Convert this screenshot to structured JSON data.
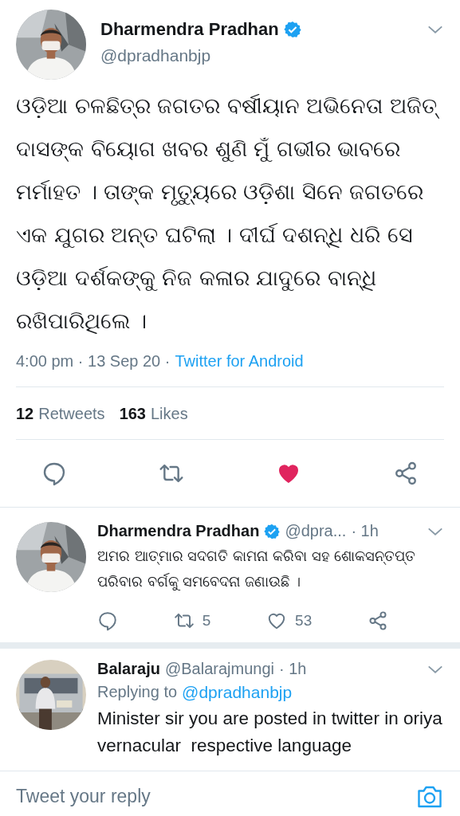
{
  "tweet": {
    "author": {
      "name": "Dharmendra Pradhan",
      "verified": true,
      "handle": "@dpradhanbjp"
    },
    "text": "ଓଡ଼ିଆ ଚଳଛିତ୍ର ଜଗତର ବର୍ଷୀୟାନ ଅଭିନେତା ଅଜିତ୍ ଦାସଙ୍କ ବିୟୋଗ ଖବର ଶୁଣି ମୁଁ ଗଭୀର ଭାବରେ ମର୍ମାହତ । ତାଙ୍କ ମୃତ୍ୟୁରେ ଓଡ଼ିଶା ସିନେ ଜଗତରେ ଏକ ଯୁଗର ଅନ୍ତ ଘଟିଲା । ଦୀର୍ଘ ଦଶନ୍ଧି ଧରି ସେ ଓଡ଼ିଆ ଦର୍ଶକଙ୍କୁ ନିଜ କଳାର ଯାଦୁରେ ବାନ୍ଧି ରଖିପାରିଥିଲେ ।",
    "meta": "4:00 pm · 13 Sep 20 ·",
    "source": "Twitter for Android",
    "stats": [
      {
        "count": "12",
        "label": "Retweets"
      },
      {
        "count": "163",
        "label": "Likes"
      }
    ],
    "liked": true
  },
  "replies": [
    {
      "author": {
        "name": "Dharmendra Pradhan",
        "verified": true,
        "handle": "@dpra..."
      },
      "time": "· 1h",
      "text": "ଅମର ଆତ୍ମାର ସଦଗତି କାମନା କରିବା ସହ ଶୋକସନ୍ତପ୍ତ ପରିବାର ବର୍ଗକୁ ସମବେଦନା ଜଣାଉଛି ।",
      "retweets": "5",
      "likes": "53",
      "liked": false
    },
    {
      "author": {
        "name": "Balaraju",
        "handle": "@Balarajmungi"
      },
      "time": "· 1h",
      "replying_label": "Replying to",
      "replying_to": "@dpradhanbjp",
      "text": "Minister sir you are posted in twitter in oriya  vernacular  respective language"
    }
  ],
  "reply_box": {
    "placeholder": "Tweet your reply"
  }
}
